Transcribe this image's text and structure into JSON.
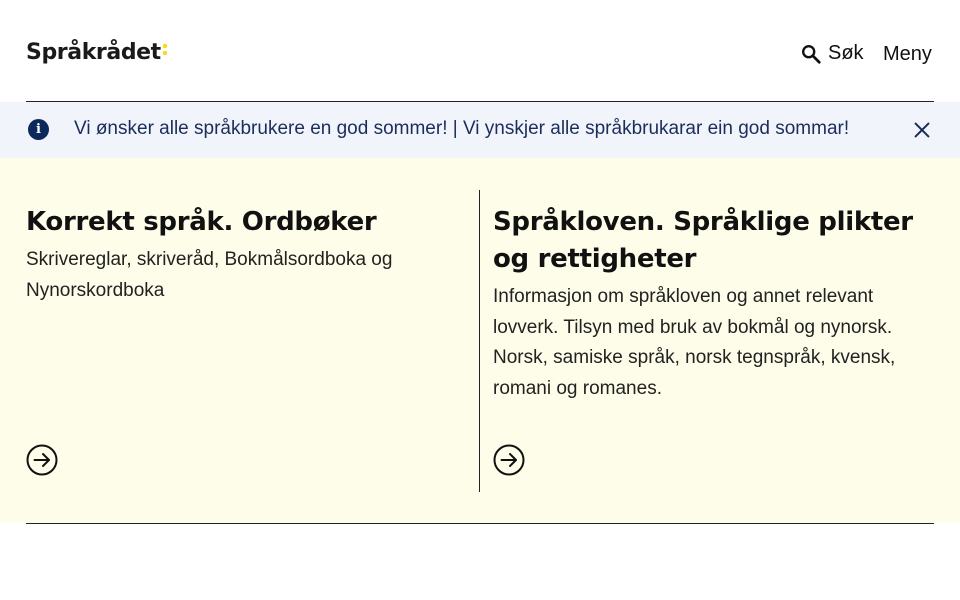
{
  "header": {
    "logo_text": "Språkrådet",
    "search_label": "Søk",
    "menu_label": "Meny"
  },
  "banner": {
    "icon": "info-icon",
    "message": "Vi ønsker alle språkbrukere en god sommer! | Vi ynskjer alle språkbrukarar ein god sommar!"
  },
  "cards": [
    {
      "title": "Korrekt språk. Ordbøker",
      "description": "Skrivereglar, skriveråd, Bokmålsordboka og Nynorskordboka"
    },
    {
      "title": "Språkloven. Språklige plikter og rettigheter",
      "description": "Informasjon om språkloven og annet relevant lovverk. Tilsyn med bruk av bokmål og nynorsk. Norsk, samiske språk, norsk tegnspråk, kvensk, romani og romanes."
    }
  ],
  "colors": {
    "banner_bg": "#f1f4fb",
    "cards_bg": "#fefde9",
    "logo_accent": "#f5dc1c",
    "info_icon": "#0b2a5b"
  }
}
